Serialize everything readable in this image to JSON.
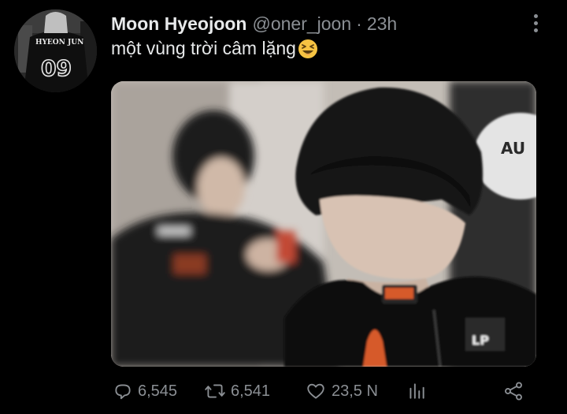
{
  "tweet": {
    "author_name": "Moon Hyeojoon",
    "author_handle": "@oner_joon",
    "separator": "·",
    "time": "23h",
    "text": "một vùng trời câm lặng",
    "emoji": "laughing-face-emoji",
    "avatar_jersey_name": "HYEON JUN",
    "avatar_jersey_number": "09",
    "media_caption_visible": "AU",
    "media_logo_text": "LP"
  },
  "actions": {
    "reply_count": "6,545",
    "retweet_count": "6,541",
    "like_count": "23,5 N"
  },
  "icons": {
    "reply": "reply-bubble-icon",
    "retweet": "retweet-icon",
    "like": "heart-icon",
    "stats": "analytics-bars-icon",
    "share": "share-icon",
    "more": "more-vertical-icon"
  },
  "colors": {
    "background": "#000000",
    "text_primary": "#e7e9ea",
    "text_secondary": "#8b8f94"
  }
}
